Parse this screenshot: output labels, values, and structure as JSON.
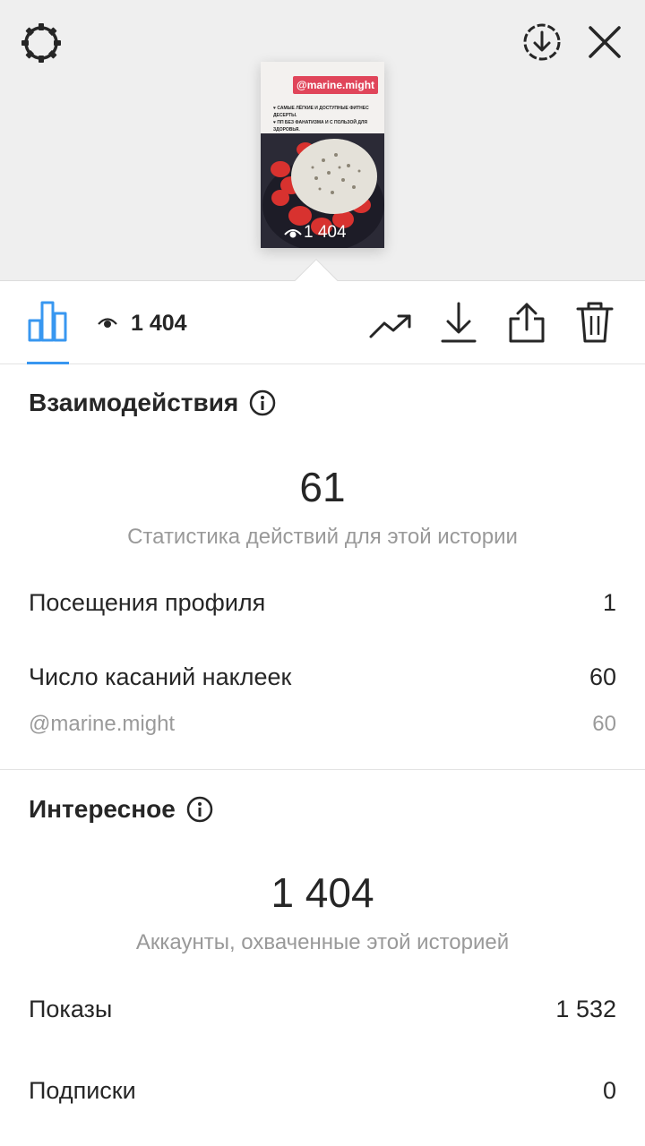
{
  "preview": {
    "tag": "@marine.might",
    "text_line1": "♥ самые лёгкие и доступные фитнес десерты.",
    "text_line2": "♥ пп без фанатизма и с пользой для здоровья.",
    "views": "1 404"
  },
  "toolbar": {
    "views_count": "1 404"
  },
  "interactions": {
    "title": "Взаимодействия",
    "total": "61",
    "caption": "Статистика действий для этой истории",
    "rows": [
      {
        "label": "Посещения профиля",
        "value": "1"
      },
      {
        "label": "Число касаний наклеек",
        "value": "60"
      },
      {
        "label": "@marine.might",
        "value": "60"
      }
    ]
  },
  "discovery": {
    "title": "Интересное",
    "total": "1 404",
    "caption": "Аккаунты, охваченные этой историей",
    "rows": [
      {
        "label": "Показы",
        "value": "1 532"
      },
      {
        "label": "Подписки",
        "value": "0"
      }
    ]
  },
  "colors": {
    "accent": "#3897f0",
    "tag_bg": "#e0455a",
    "muted_text": "#999999"
  },
  "icons": [
    "settings-icon",
    "download-circle-icon",
    "close-icon",
    "bar-chart-icon",
    "eye-icon",
    "trend-icon",
    "download-icon",
    "share-icon",
    "trash-icon",
    "info-icon"
  ]
}
